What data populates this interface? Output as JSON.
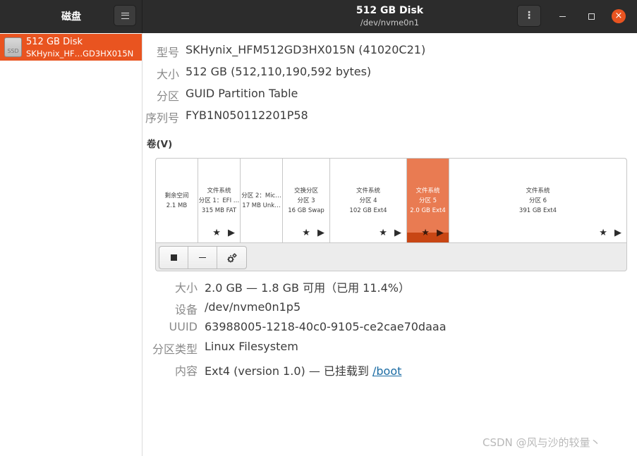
{
  "header": {
    "app_title": "磁盘",
    "window_title": "512 GB Disk",
    "window_subtitle": "/dev/nvme0n1",
    "menu_glyph": "⋮",
    "close_glyph": "×",
    "accent_color": "#e95420"
  },
  "sidebar": {
    "items": [
      {
        "name": "512 GB Disk",
        "model": "SKHynix_HF…GD3HX015N",
        "icon_label": "SSD",
        "icon": "ssd-drive-icon"
      }
    ]
  },
  "disk_info": {
    "model": {
      "label": "型号",
      "value": "SKHynix_HFM512GD3HX015N (41020C21)"
    },
    "size": {
      "label": "大小",
      "value": "512 GB (512,110,190,592 bytes)"
    },
    "partitioning": {
      "label": "分区",
      "value": "GUID Partition Table"
    },
    "serial": {
      "label": "序列号",
      "value": "FYB1N050112201P58"
    }
  },
  "volumes": {
    "heading": "卷(V)",
    "segments": [
      {
        "line1": "剩余空间",
        "line2": "2.1 MB",
        "line3": ""
      },
      {
        "line1": "文件系统",
        "line2": "分区 1：EFI …",
        "line3": "315 MB FAT"
      },
      {
        "line1": "分区 2：Mic…",
        "line2": "17 MB Unk…",
        "line3": ""
      },
      {
        "line1": "交换分区",
        "line2": "分区 3",
        "line3": "16 GB Swap"
      },
      {
        "line1": "文件系统",
        "line2": "分区 4",
        "line3": "102 GB Ext4"
      },
      {
        "line1": "文件系统",
        "line2": "分区 5",
        "line3": "2.0 GB Ext4"
      },
      {
        "line1": "文件系统",
        "line2": "分区 6",
        "line3": "391 GB Ext4"
      }
    ],
    "selected_segment": 5,
    "selected_usage_fraction": 0.114,
    "segment_icons": "★ ▶",
    "toolbar": {
      "stop": "stop-icon",
      "remove": "minus-icon",
      "settings": "gears-icon"
    }
  },
  "partition_details": {
    "size": {
      "label": "大小",
      "value": "2.0 GB — 1.8 GB 可用（已用 11.4%）"
    },
    "device": {
      "label": "设备",
      "value": "/dev/nvme0n1p5"
    },
    "uuid": {
      "label": "UUID",
      "value": "63988005-1218-40c0-9105-ce2cae70daaa"
    },
    "type": {
      "label": "分区类型",
      "value": "Linux Filesystem"
    },
    "contents": {
      "label": "内容",
      "value_prefix": "Ext4 (version 1.0) — 已挂载到 ",
      "mount_link": "/boot"
    }
  },
  "watermark": "CSDN @风与沙的较量丶"
}
